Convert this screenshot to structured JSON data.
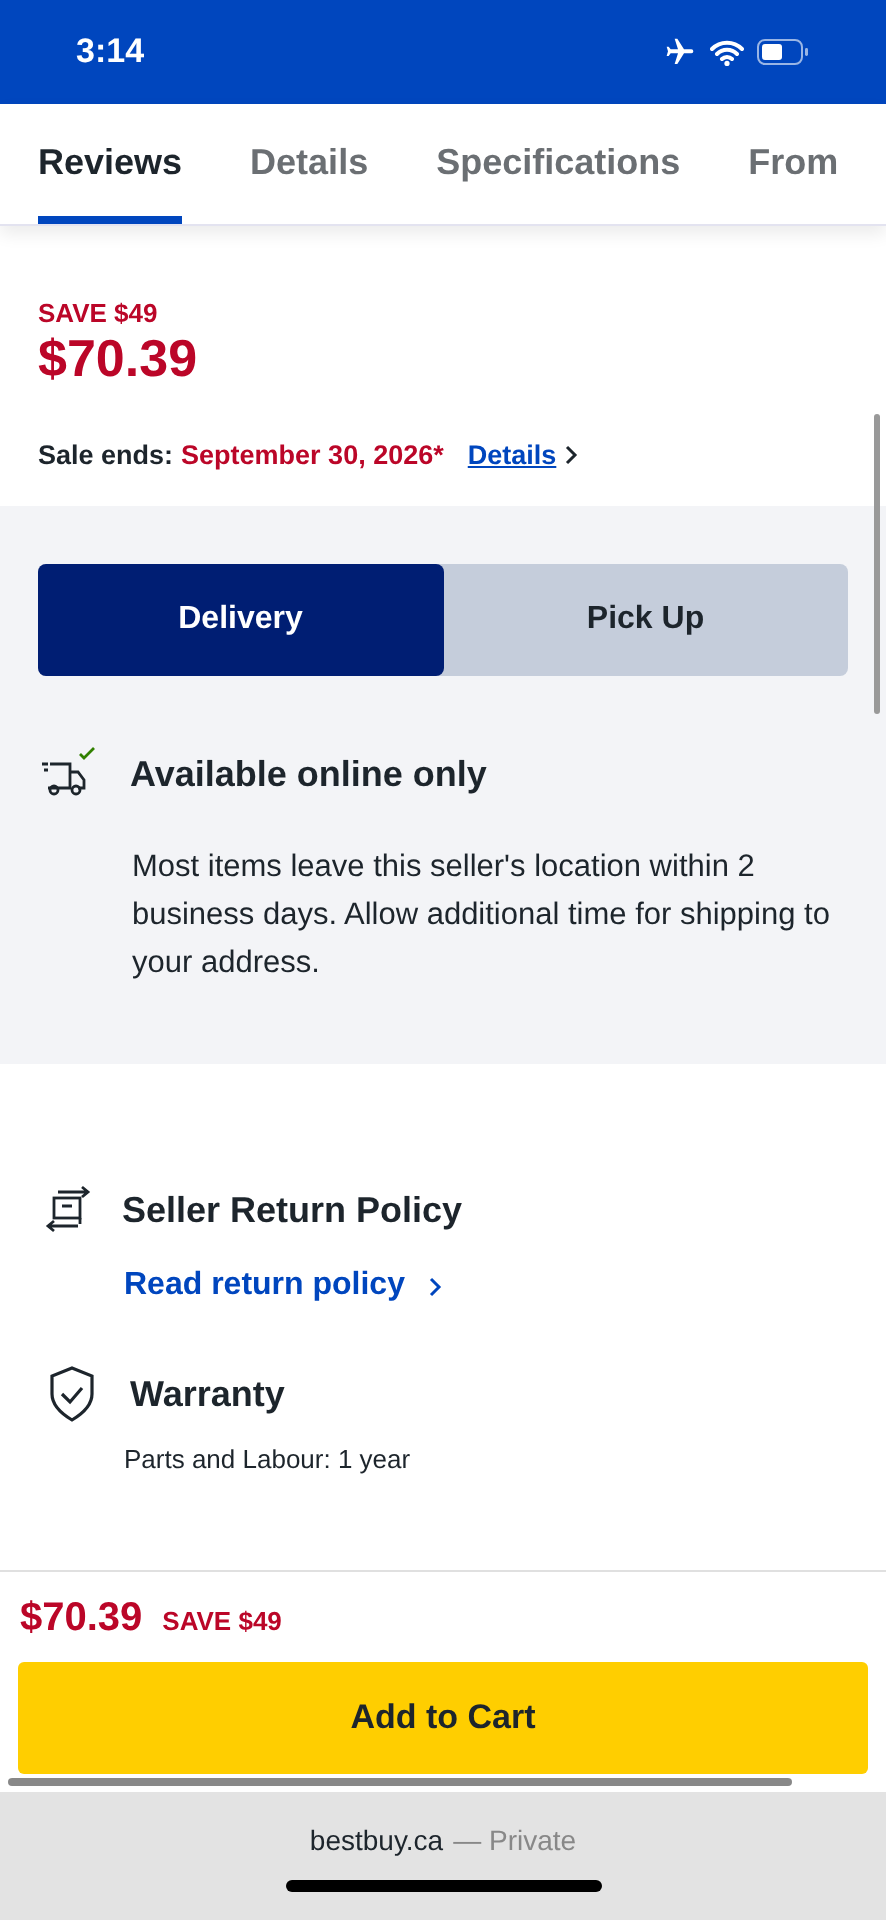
{
  "status_bar": {
    "time": "3:14"
  },
  "tabs": [
    {
      "label": "Reviews",
      "selected": true
    },
    {
      "label": "Details",
      "selected": false
    },
    {
      "label": "Specifications",
      "selected": false
    },
    {
      "label": "From",
      "selected": false
    }
  ],
  "price_block": {
    "save": "SAVE $49",
    "price": "$70.39",
    "sale_label": "Sale ends:",
    "sale_date": "September 30, 2026*",
    "details_link": "Details"
  },
  "fulfillment_options": [
    {
      "label": "Delivery",
      "selected": true
    },
    {
      "label": "Pick Up",
      "selected": false
    }
  ],
  "availability": {
    "title": "Available online only",
    "description": "Most items leave this seller's location within 2 business days. Allow additional time for shipping to your address."
  },
  "return_policy": {
    "title": "Seller Return Policy",
    "link": "Read return policy"
  },
  "warranty": {
    "title": "Warranty",
    "detail": "Parts and Labour: 1 year"
  },
  "sticky_bar": {
    "price": "$70.39",
    "save": "SAVE $49",
    "button": "Add to Cart"
  },
  "browser_bar": {
    "domain": "bestbuy.ca",
    "mode": "— Private"
  }
}
